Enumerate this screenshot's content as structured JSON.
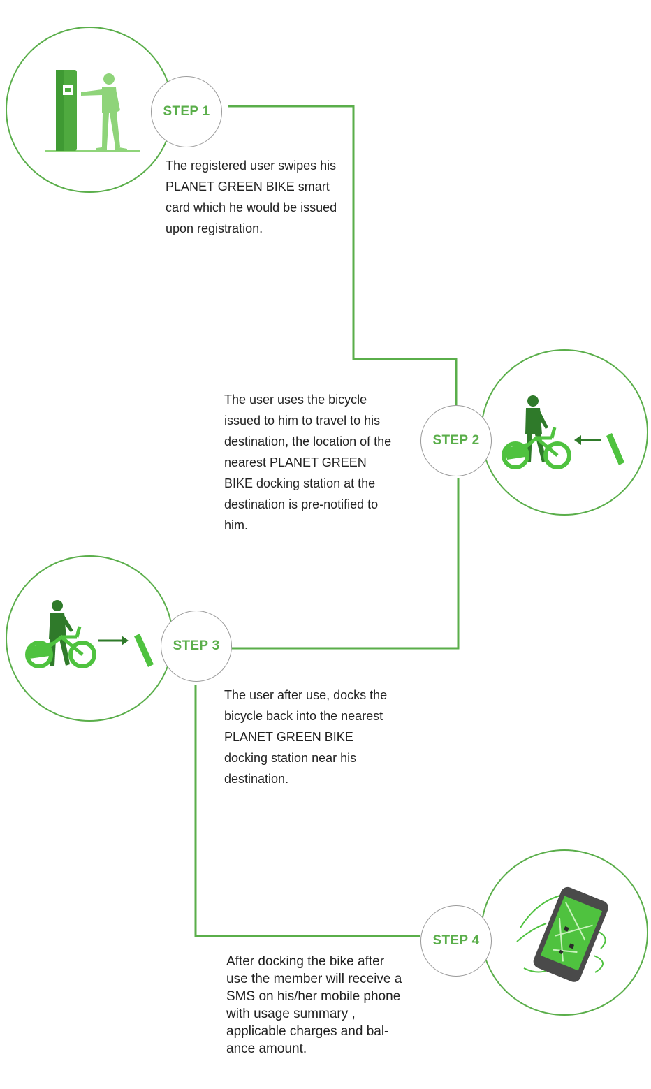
{
  "steps": [
    {
      "label": "STEP 1",
      "icon": "kiosk-card-swipe-icon",
      "description": "The registered user swipes his PLANET GREEN BIKE smart card which he would be issued upon registration."
    },
    {
      "label": "STEP 2",
      "icon": "user-riding-bicycle-icon",
      "description": "The user uses the bicycle issued to him to travel to his destination, the location of the nearest PLANET GREEN BIKE docking station at the destination is pre-notified to him."
    },
    {
      "label": "STEP 3",
      "icon": "bicycle-docking-icon",
      "description": "The user after use, docks the bicycle back into the nearest PLANET GREEN BIKE docking station near his destination."
    },
    {
      "label": "STEP 4",
      "icon": "mobile-sms-icon",
      "description": "After docking the bike after use the member will receive a SMS on his/her mobile phone with usage summary , applicable charges and bal-ance amount."
    }
  ],
  "colors": {
    "accent": "#5aae4a",
    "accent_light": "#8fd47a",
    "accent_dark": "#2f7a2a",
    "badge_border": "#9a9a9a",
    "text": "#222222"
  }
}
